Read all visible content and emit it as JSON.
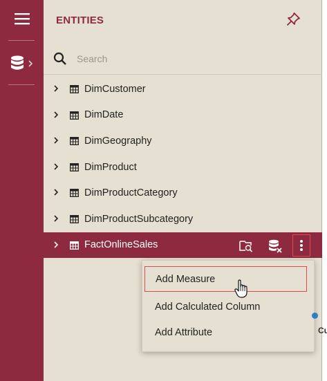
{
  "rail": {
    "menu_icon": "hamburger-icon",
    "db_icon": "database-icon",
    "chevron_icon": "chevron-right-icon"
  },
  "panel": {
    "title": "ENTITIES",
    "pin_icon": "pin-icon"
  },
  "search": {
    "placeholder": "Search",
    "value": "",
    "icon": "search-icon"
  },
  "entities": [
    {
      "label": "DimCustomer"
    },
    {
      "label": "DimDate"
    },
    {
      "label": "DimGeography"
    },
    {
      "label": "DimProduct"
    },
    {
      "label": "DimProductCategory"
    },
    {
      "label": "DimProductSubcategory"
    },
    {
      "label": "FactOnlineSales",
      "selected": true
    }
  ],
  "row_actions": {
    "view_icon": "search-table-icon",
    "db_icon": "database-remove-icon",
    "more_icon": "more-vertical-icon"
  },
  "context_menu": {
    "items": [
      {
        "label": "Add Measure",
        "highlighted": true
      },
      {
        "label": "Add Calculated Column"
      },
      {
        "label": "Add Attribute"
      }
    ]
  },
  "canvas": {
    "partial_label": "Cu"
  },
  "colors": {
    "brand": "#8d2a3f",
    "panel_bg": "#e5e0d2",
    "highlight_border": "#e34a4a"
  }
}
